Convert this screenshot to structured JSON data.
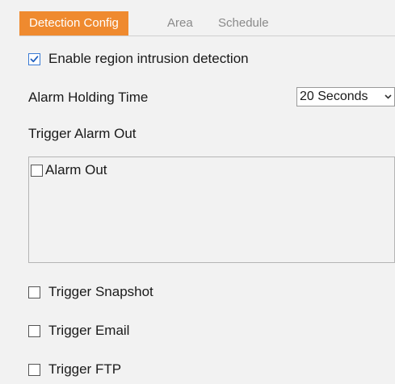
{
  "tabs": [
    {
      "label": "Detection Config",
      "active": true
    },
    {
      "label": "Area",
      "active": false
    },
    {
      "label": "Schedule",
      "active": false
    }
  ],
  "enable_detection": {
    "label": "Enable region intrusion detection",
    "checked": true
  },
  "alarm_holding_time": {
    "label": "Alarm Holding Time",
    "value": "20 Seconds"
  },
  "trigger_alarm_out": {
    "label": "Trigger Alarm Out",
    "items": [
      {
        "label": "Alarm Out",
        "checked": false
      }
    ]
  },
  "triggers": [
    {
      "label": "Trigger Snapshot",
      "checked": false
    },
    {
      "label": "Trigger Email",
      "checked": false
    },
    {
      "label": "Trigger FTP",
      "checked": false
    }
  ],
  "colors": {
    "accent": "#ef8a2f",
    "background": "#f2f2f2",
    "check": "#3a7bd5"
  },
  "icons": {
    "checkbox_checked": "check-icon",
    "select": "chevron-down-icon"
  }
}
